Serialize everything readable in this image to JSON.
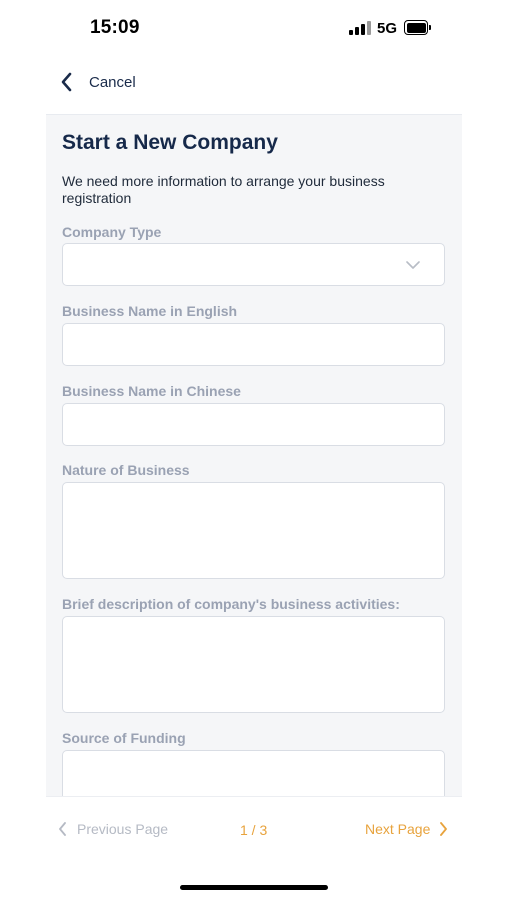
{
  "status_bar": {
    "time": "15:09",
    "network": "5G",
    "icons": [
      "signal-icon",
      "battery-icon"
    ]
  },
  "nav": {
    "back_label": "Cancel",
    "icon": "chevron-left-icon"
  },
  "form": {
    "title": "Start a New Company",
    "subtitle": "We need more information to arrange your business registration",
    "fields": [
      {
        "label": "Company Type",
        "value": "",
        "type": "select"
      },
      {
        "label": "Business Name in English",
        "value": "",
        "type": "text"
      },
      {
        "label": "Business Name in Chinese",
        "value": "",
        "type": "text"
      },
      {
        "label": "Nature of Business",
        "value": "",
        "type": "textarea"
      },
      {
        "label": "Brief description of company's business activities:",
        "value": "",
        "type": "textarea"
      },
      {
        "label": "Source of Funding",
        "value": "",
        "type": "textarea"
      }
    ]
  },
  "footer": {
    "prev_label": "Previous Page",
    "page_indicator": "1 / 3",
    "next_label": "Next Page"
  },
  "colors": {
    "accent": "#e8a33d",
    "title": "#16294a",
    "label": "#9aa2b3",
    "disabled": "#b5bac4",
    "panel_bg": "#f5f6f8"
  }
}
